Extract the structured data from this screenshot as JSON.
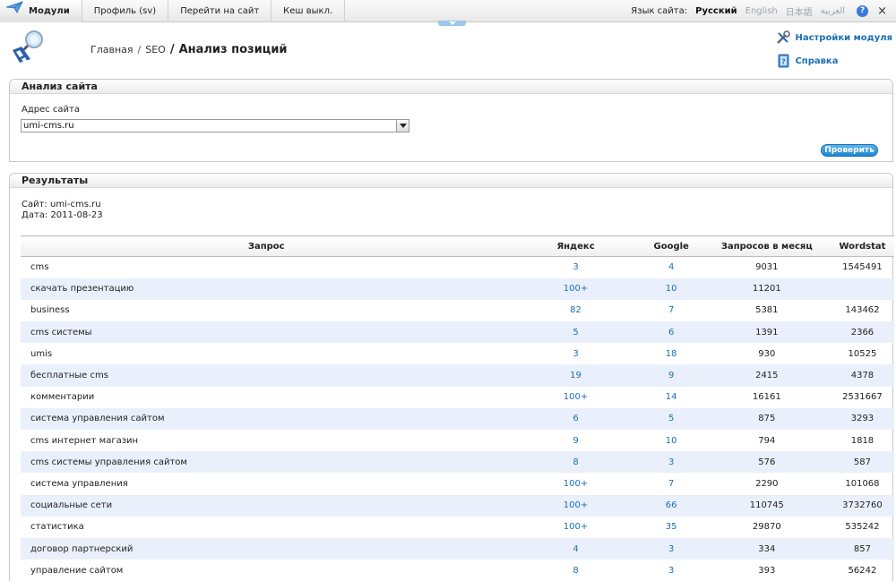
{
  "topnav": {
    "modules": "Модули",
    "profile": "Профиль (sv)",
    "go_site": "Перейти на сайт",
    "cache": "Кеш выкл."
  },
  "langbar": {
    "label": "Язык сайта:",
    "languages": [
      "Русский",
      "English",
      "日本語",
      "العربية"
    ],
    "active": "Русский"
  },
  "breadcrumb": {
    "home": "Главная",
    "sep1": "/",
    "seo": "SEO",
    "sep2": "/",
    "current": "Анализ позиций"
  },
  "side_links": {
    "settings": "Настройки модуля",
    "help": "Справка"
  },
  "analysis_panel": {
    "title": "Анализ сайта",
    "field_label": "Адрес сайта",
    "field_value": "umi-cms.ru",
    "button": "Проверить"
  },
  "results_panel": {
    "title": "Результаты",
    "site_line": "Сайт: umi-cms.ru",
    "date_line": "Дата: 2011-08-23",
    "columns": [
      "Запрос",
      "Яндекс",
      "Google",
      "Запросов в месяц",
      "Wordstat"
    ],
    "rows": [
      {
        "query": "cms",
        "yandex": "3",
        "google": "4",
        "monthly": "9031",
        "wordstat": "1545491"
      },
      {
        "query": "скачать презентацию",
        "yandex": "100+",
        "google": "10",
        "monthly": "11201",
        "wordstat": ""
      },
      {
        "query": "business",
        "yandex": "82",
        "google": "7",
        "monthly": "5381",
        "wordstat": "143462"
      },
      {
        "query": "cms системы",
        "yandex": "5",
        "google": "6",
        "monthly": "1391",
        "wordstat": "2366"
      },
      {
        "query": "umis",
        "yandex": "3",
        "google": "18",
        "monthly": "930",
        "wordstat": "10525"
      },
      {
        "query": "бесплатные cms",
        "yandex": "19",
        "google": "9",
        "monthly": "2415",
        "wordstat": "4378"
      },
      {
        "query": "комментарии",
        "yandex": "100+",
        "google": "14",
        "monthly": "16161",
        "wordstat": "2531667"
      },
      {
        "query": "система управления сайтом",
        "yandex": "6",
        "google": "5",
        "monthly": "875",
        "wordstat": "3293"
      },
      {
        "query": "cms интернет магазин",
        "yandex": "9",
        "google": "10",
        "monthly": "794",
        "wordstat": "1818"
      },
      {
        "query": "cms системы управления сайтом",
        "yandex": "8",
        "google": "3",
        "monthly": "576",
        "wordstat": "587"
      },
      {
        "query": "система управления",
        "yandex": "100+",
        "google": "7",
        "monthly": "2290",
        "wordstat": "101068"
      },
      {
        "query": "социальные сети",
        "yandex": "100+",
        "google": "66",
        "monthly": "110745",
        "wordstat": "3732760"
      },
      {
        "query": "статистика",
        "yandex": "100+",
        "google": "35",
        "monthly": "29870",
        "wordstat": "535242"
      },
      {
        "query": "договор партнерский",
        "yandex": "4",
        "google": "3",
        "monthly": "334",
        "wordstat": "857"
      },
      {
        "query": "управление сайтом",
        "yandex": "8",
        "google": "3",
        "monthly": "393",
        "wordstat": "56242"
      }
    ]
  },
  "colors": {
    "link": "#1c6fb5",
    "row_alt": "#eaf0fb",
    "button": "#1f86d3"
  },
  "icons": {
    "modules": "paper-plane-icon",
    "logo": "magnifier-logo-icon",
    "settings": "tools-icon",
    "help": "help-book-icon",
    "help_top": "help-circle-icon",
    "close": "close-icon",
    "dropdown": "chevron-down-icon"
  }
}
